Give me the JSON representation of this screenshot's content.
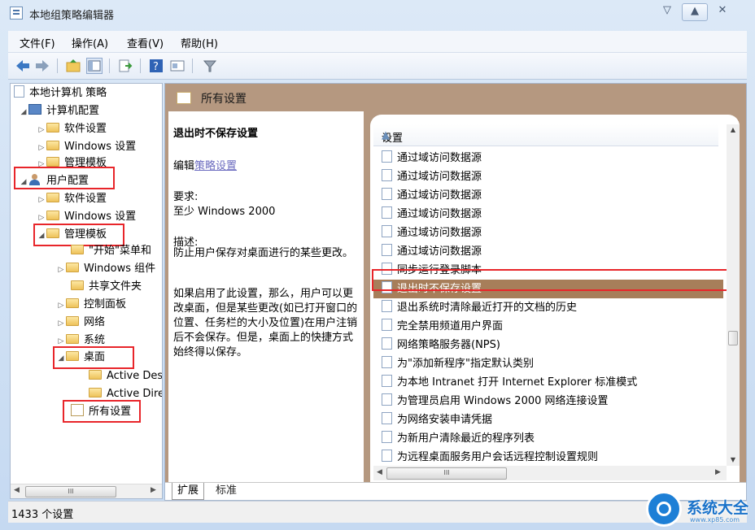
{
  "window": {
    "title": "本地组策略编辑器",
    "min": "▽",
    "max": "▲",
    "close": "✕"
  },
  "menu": [
    "文件(F)",
    "操作(A)",
    "查看(V)",
    "帮助(H)"
  ],
  "tree": {
    "root": "本地计算机 策略",
    "computer_config": "计算机配置",
    "cc_software": "软件设置",
    "cc_windows": "Windows 设置",
    "cc_admin": "管理模板",
    "user_config": "用户配置",
    "uc_software": "软件设置",
    "uc_windows": "Windows 设置",
    "uc_admin": "管理模板",
    "start_menu": "\"开始\"菜单和",
    "win_components": "Windows 组件",
    "shared_folders": "共享文件夹",
    "control_panel": "控制面板",
    "network": "网络",
    "system": "系统",
    "desktop": "桌面",
    "active_desktop": "Active Desktop",
    "active_directory": "Active Directory",
    "all_settings": "所有设置",
    "scroll_label": "III"
  },
  "right_header": "所有设置",
  "description": {
    "title": "退出时不保存设置",
    "edit_prefix": "编辑",
    "edit_link": "策略设置",
    "req_label": "要求:",
    "req_value": "至少 Windows 2000",
    "desc_label": "描述:",
    "desc_text": "防止用户保存对桌面进行的某些更改。",
    "detail_text": "如果启用了此设置，那么，用户可以更改桌面，但是某些更改(如已打开窗口的位置、任务栏的大小及位置)在用户注销后不会保存。但是，桌面上的快捷方式始终得以保存。"
  },
  "list": {
    "column": "设置",
    "rows": [
      "通过域访问数据源",
      "通过域访问数据源",
      "通过域访问数据源",
      "通过域访问数据源",
      "通过域访问数据源",
      "通过域访问数据源",
      "同步运行登录脚本",
      "退出时不保存设置",
      "退出系统时清除最近打开的文档的历史",
      "完全禁用频道用户界面",
      "网络策略服务器(NPS)",
      "为\"添加新程序\"指定默认类别",
      "为本地 Intranet 打开 Internet Explorer 标准模式",
      "为管理员启用 Windows 2000 网络连接设置",
      "为网络安装申请凭据",
      "为新用户清除最近的程序列表",
      "为远程桌面服务用户会话远程控制设置规则"
    ],
    "selected_index": 7,
    "scroll_label": "III"
  },
  "tabs": [
    "扩展",
    "标准"
  ],
  "status": "1433 个设置",
  "watermark": {
    "title": "系统大全",
    "sub": "www.xp85.com"
  },
  "colors": {
    "highlight": "#a77e5a",
    "redbox": "#e8252a",
    "pane_header": "#b59880"
  }
}
